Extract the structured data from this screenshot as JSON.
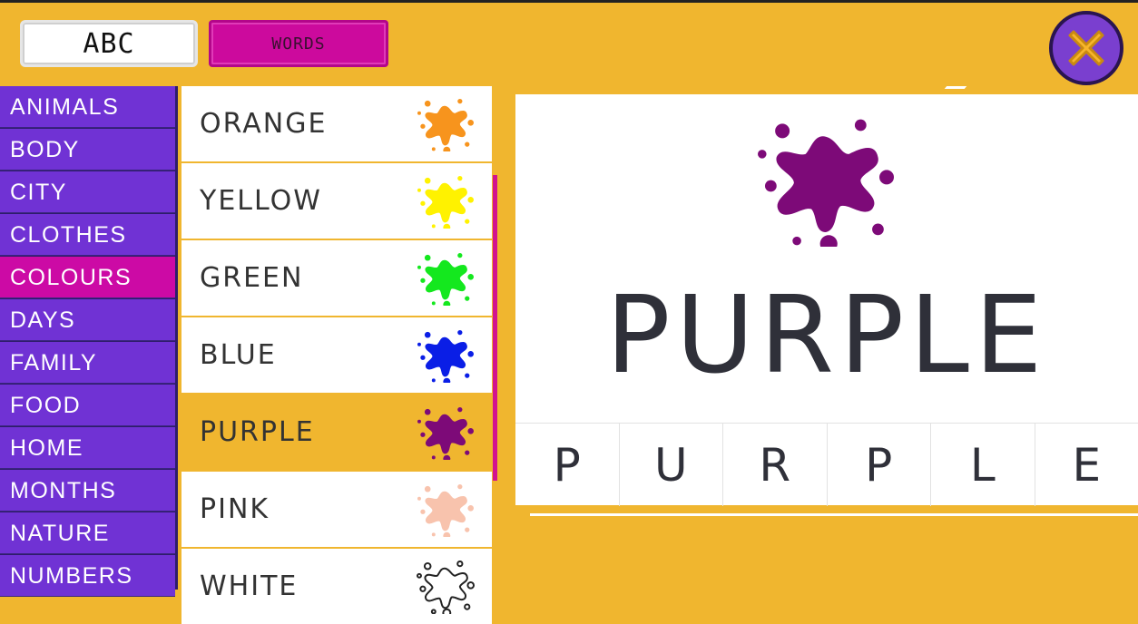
{
  "modes": {
    "abc_label": "ABC",
    "words_label": "WORDS"
  },
  "categories": [
    {
      "label": "ANIMALS"
    },
    {
      "label": "BODY"
    },
    {
      "label": "CITY"
    },
    {
      "label": "CLOTHES"
    },
    {
      "label": "COLOURS",
      "selected": true
    },
    {
      "label": "DAYS"
    },
    {
      "label": "FAMILY"
    },
    {
      "label": "FOOD"
    },
    {
      "label": "HOME"
    },
    {
      "label": "MONTHS"
    },
    {
      "label": "NATURE"
    },
    {
      "label": "NUMBERS"
    }
  ],
  "words": [
    {
      "label": "ORANGE",
      "color": "#f7941d",
      "icon": "orange-paint-splat-icon"
    },
    {
      "label": "YELLOW",
      "color": "#fff200",
      "icon": "yellow-paint-splat-icon"
    },
    {
      "label": "GREEN",
      "color": "#14e81e",
      "icon": "green-paint-splat-icon"
    },
    {
      "label": "BLUE",
      "color": "#0a1ee6",
      "icon": "blue-paint-splat-icon"
    },
    {
      "label": "PURPLE",
      "color": "#7d0a78",
      "icon": "purple-paint-splat-icon",
      "selected": true
    },
    {
      "label": "PINK",
      "color": "#f8c3ad",
      "icon": "pink-paint-splat-icon"
    },
    {
      "label": "WHITE",
      "color": "#ffffff",
      "icon": "white-paint-splat-icon"
    }
  ],
  "detail": {
    "word": "PURPLE",
    "color": "#7d0a78",
    "letters": [
      "P",
      "U",
      "R",
      "P",
      "L",
      "E"
    ]
  },
  "colors": {
    "background": "#f0b62f",
    "sidebar_item": "#7032d4",
    "selected_category": "#cc0aa5",
    "words_button": "#cc0a9d",
    "close_button": "#7a3fcf",
    "close_x": "#f7b52c"
  }
}
